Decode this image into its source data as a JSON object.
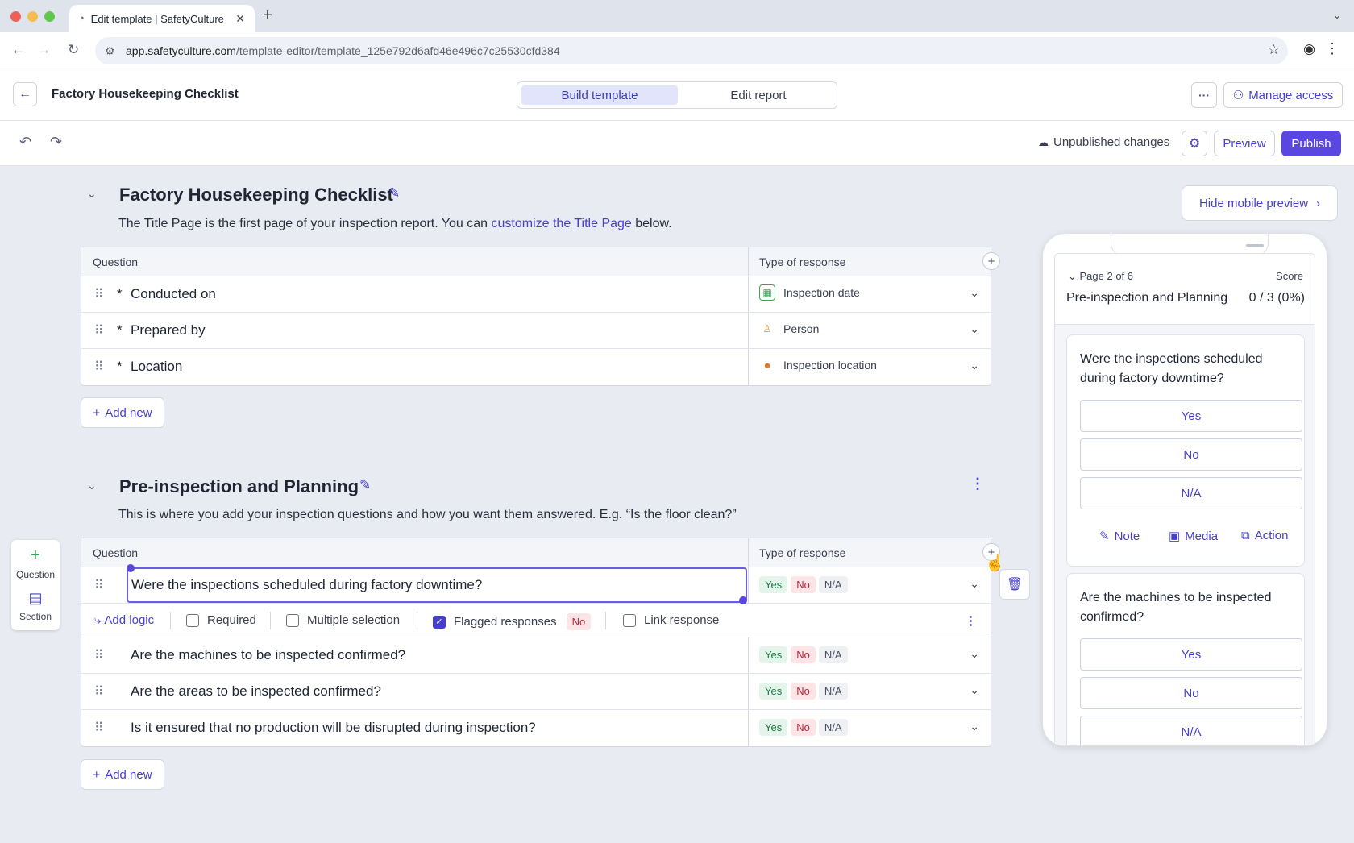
{
  "browser": {
    "tab_title": "Edit template | SafetyCulture",
    "url_host": "app.safetyculture.com",
    "url_path": "/template-editor/template_125e792d6afd46e496c7c25530cfd384"
  },
  "header": {
    "title": "Factory Housekeeping Checklist",
    "modes": [
      "Build template",
      "Edit report"
    ],
    "manage_access": "Manage access"
  },
  "toolbar": {
    "status": "Unpublished changes",
    "preview": "Preview",
    "publish": "Publish"
  },
  "title_page": {
    "title": "Factory Housekeeping Checklist",
    "desc_pre": "The Title Page is the first page of your inspection report. You can ",
    "desc_link": "customize the Title Page",
    "desc_post": " below.",
    "col_question": "Question",
    "col_type": "Type of response",
    "rows": [
      {
        "required": "*",
        "text": "Conducted on",
        "type": "Inspection date",
        "icon": "calendar-icon"
      },
      {
        "required": "*",
        "text": "Prepared by",
        "type": "Person",
        "icon": "person-icon"
      },
      {
        "required": "*",
        "text": "Location",
        "type": "Inspection location",
        "icon": "pin-icon"
      }
    ],
    "add_new": "Add new"
  },
  "section": {
    "title": "Pre-inspection and Planning",
    "desc": "This is where you add your inspection questions and how you want them answered. E.g. “Is the floor clean?”",
    "col_question": "Question",
    "col_type": "Type of response",
    "selected_question": "Were the inspections scheduled during factory downtime?",
    "options": {
      "add_logic": "Add logic",
      "required": "Required",
      "multiple": "Multiple selection",
      "flagged": "Flagged responses",
      "flagged_value": "No",
      "link": "Link response"
    },
    "rows": [
      {
        "text": "Are the machines to be inspected confirmed?"
      },
      {
        "text": "Are the areas to be inspected confirmed?"
      },
      {
        "text": "Is it ensured that no production will be disrupted during inspection?"
      }
    ],
    "responses": {
      "yes": "Yes",
      "no": "No",
      "na": "N/A"
    },
    "add_new": "Add new"
  },
  "side_tools": {
    "question": "Question",
    "section": "Section"
  },
  "mobile": {
    "hide_label": "Hide mobile preview",
    "page_label": "Page 2 of 6",
    "score_label": "Score",
    "page_title": "Pre-inspection and Planning",
    "score_value": "0 / 3 (0%)",
    "q1": "Were the inspections scheduled during factory downtime?",
    "q2": "Are the machines to be inspected confirmed?",
    "answers": [
      "Yes",
      "No",
      "N/A"
    ],
    "note": "Note",
    "media": "Media",
    "action": "Action"
  },
  "colors": {
    "accent": "#4740c8",
    "publish": "#5a47e0",
    "yes": "#1d7a43",
    "no": "#c2233a"
  }
}
